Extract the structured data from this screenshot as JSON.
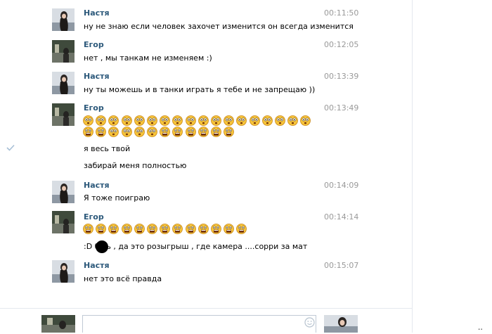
{
  "messages": [
    {
      "sender": "Настя",
      "time": "00:11:50",
      "lines": [
        "ну не знаю если человек захочет изменится он всегда изменится"
      ]
    },
    {
      "sender": "Егор",
      "time": "00:12:05",
      "lines": [
        "нет , мы танкам не изменяем :)"
      ]
    },
    {
      "sender": "Настя",
      "time": "00:13:39",
      "lines": [
        "ну ты можешь и в танки играть я тебе и не запрещаю ))"
      ]
    },
    {
      "sender": "Егор",
      "time": "00:13:49",
      "emoji_rows": [
        [
          "shocked",
          "shocked",
          "shocked",
          "shocked",
          "shocked",
          "shocked",
          "shocked",
          "shocked",
          "shocked",
          "shocked",
          "shocked",
          "shocked",
          "shocked",
          "shocked",
          "shocked",
          "shocked",
          "shocked",
          "shocked"
        ],
        [
          "screaming",
          "screaming",
          "shocked",
          "shocked",
          "shocked",
          "shocked",
          "screaming",
          "screaming",
          "screaming",
          "screaming",
          "screaming",
          "screaming"
        ]
      ],
      "lines": [
        "я весь твой",
        "забирай меня полностью"
      ]
    },
    {
      "sender": "Настя",
      "time": "00:14:09",
      "lines": [
        "Я тоже поиграю"
      ]
    },
    {
      "sender": "Егор",
      "time": "00:14:14",
      "emoji_rows": [
        [
          "screaming",
          "screaming",
          "screaming",
          "screaming",
          "screaming",
          "screaming",
          "screaming",
          "screaming",
          "screaming",
          "screaming",
          "screaming",
          "screaming",
          "screaming"
        ]
      ],
      "lines": [
        ":D б   ть , да это розыгрыш , где камера ....сорри за мат"
      ]
    },
    {
      "sender": "Настя",
      "time": "00:15:07",
      "lines": [
        "нет это всё правда"
      ]
    }
  ],
  "compose": {
    "placeholder": ""
  },
  "colors": {
    "name": "#2b587a",
    "time": "#999999",
    "emoji_face": "#f7c43a",
    "emoji_outline": "#c9881a"
  },
  "icons": {
    "sent_check": "checkmark-icon",
    "smile": "smile-icon"
  }
}
